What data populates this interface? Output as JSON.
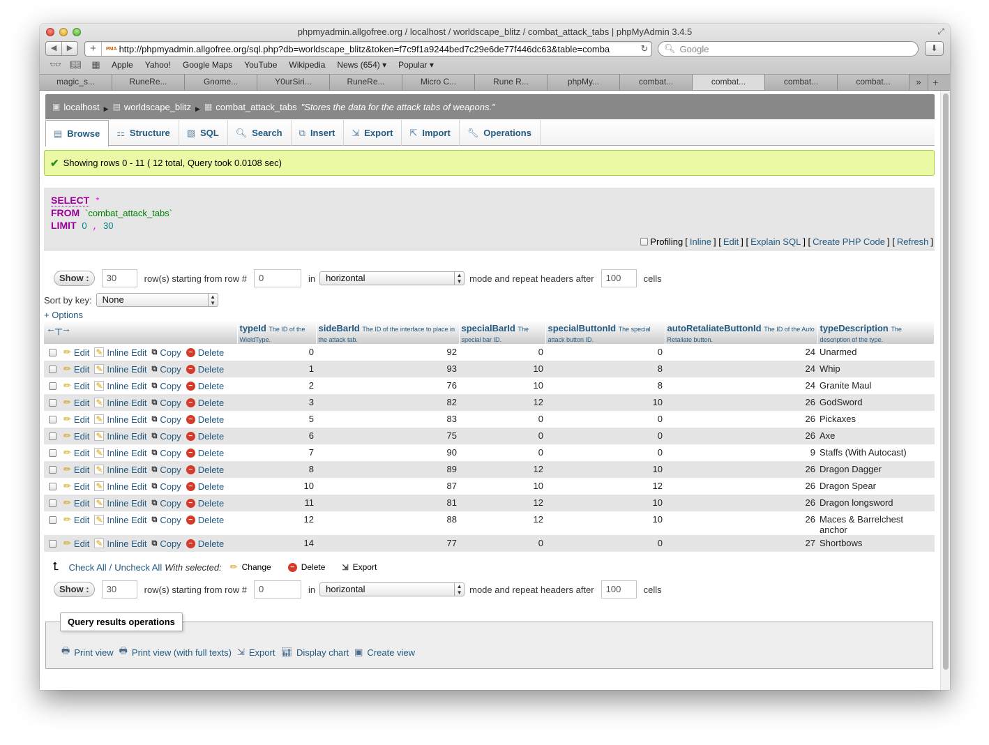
{
  "browser": {
    "window_title": "phpmyadmin.allgofree.org / localhost / worldscape_blitz / combat_attack_tabs | phpMyAdmin 3.4.5",
    "url": "http://phpmyadmin.allgofree.org/sql.php?db=worldscape_blitz&token=f7c9f1a9244bed7c29e6de77f446dc63&table=comba",
    "url_favicon": "PMA",
    "search_placeholder": "Google",
    "bookmarks": [
      "Apple",
      "Yahoo!",
      "Google Maps",
      "YouTube",
      "Wikipedia",
      "News (654) ▾",
      "Popular ▾"
    ],
    "tabs": [
      "magic_s...",
      "RuneRe...",
      "Gnome...",
      "Y0urSiri...",
      "RuneRe...",
      "Micro C...",
      "Rune R...",
      "phpMy...",
      "combat...",
      "combat...",
      "combat...",
      "combat..."
    ],
    "active_tab_index": 9
  },
  "breadcrumb": {
    "server": "localhost",
    "database": "worldscape_blitz",
    "table": "combat_attack_tabs",
    "comment": "\"Stores the data for the attack tabs of weapons.\""
  },
  "pma_tabs": [
    {
      "label": "Browse",
      "icon": "browse-icon"
    },
    {
      "label": "Structure",
      "icon": "structure-icon"
    },
    {
      "label": "SQL",
      "icon": "sql-icon"
    },
    {
      "label": "Search",
      "icon": "search-icon"
    },
    {
      "label": "Insert",
      "icon": "insert-icon"
    },
    {
      "label": "Export",
      "icon": "export-icon"
    },
    {
      "label": "Import",
      "icon": "import-icon"
    },
    {
      "label": "Operations",
      "icon": "wrench-icon"
    }
  ],
  "success_message": "Showing rows 0 - 11 ( 12 total, Query took 0.0108 sec)",
  "sql": {
    "select": "SELECT",
    "star": "*",
    "from": "FROM",
    "table": "`combat_attack_tabs`",
    "limit": "LIMIT",
    "offset": "0",
    "comma": ",",
    "count": "30"
  },
  "sql_links": {
    "profiling": "Profiling",
    "inline": "Inline",
    "edit": "Edit",
    "explain": "Explain SQL",
    "create_php": "Create PHP Code",
    "refresh": "Refresh"
  },
  "nav": {
    "show_label": "Show :",
    "rows": "30",
    "starting_text": "row(s) starting from row #",
    "start_row": "0",
    "in_text": "in",
    "mode": "horizontal",
    "mode_text": "mode and repeat headers after",
    "repeat": "100",
    "cells_text": "cells"
  },
  "sort": {
    "label": "Sort by key:",
    "value": "None"
  },
  "options_link": "+ Options",
  "columns": [
    {
      "name": "typeId",
      "comment": "The ID of the WieldType."
    },
    {
      "name": "sideBarId",
      "comment": "The ID of the interface to place in the attack tab."
    },
    {
      "name": "specialBarId",
      "comment": "The special bar ID."
    },
    {
      "name": "specialButtonId",
      "comment": "The special attack button ID."
    },
    {
      "name": "autoRetaliateButtonId",
      "comment": "The ID of the Auto Retaliate button."
    },
    {
      "name": "typeDescription",
      "comment": "The description of the type."
    }
  ],
  "row_actions": {
    "edit": "Edit",
    "inline": "Inline Edit",
    "copy": "Copy",
    "delete": "Delete"
  },
  "rows": [
    [
      "0",
      "92",
      "0",
      "0",
      "24",
      "Unarmed"
    ],
    [
      "1",
      "93",
      "10",
      "8",
      "24",
      "Whip"
    ],
    [
      "2",
      "76",
      "10",
      "8",
      "24",
      "Granite Maul"
    ],
    [
      "3",
      "82",
      "12",
      "10",
      "26",
      "GodSword"
    ],
    [
      "5",
      "83",
      "0",
      "0",
      "26",
      "Pickaxes"
    ],
    [
      "6",
      "75",
      "0",
      "0",
      "26",
      "Axe"
    ],
    [
      "7",
      "90",
      "0",
      "0",
      "9",
      "Staffs (With Autocast)"
    ],
    [
      "8",
      "89",
      "12",
      "10",
      "26",
      "Dragon Dagger"
    ],
    [
      "10",
      "87",
      "10",
      "12",
      "26",
      "Dragon Spear"
    ],
    [
      "11",
      "81",
      "12",
      "10",
      "26",
      "Dragon longsword"
    ],
    [
      "12",
      "88",
      "12",
      "10",
      "26",
      "Maces & Barrelchest anchor"
    ],
    [
      "14",
      "77",
      "0",
      "0",
      "27",
      "Shortbows"
    ]
  ],
  "with_selected": {
    "check_all": "Check All",
    "separator": "/",
    "uncheck_all": "Uncheck All",
    "label": "With selected:",
    "change": "Change",
    "delete": "Delete",
    "export": "Export"
  },
  "query_ops": {
    "legend": "Query results operations",
    "print_view": "Print view",
    "print_full": "Print view (with full texts)",
    "export": "Export",
    "chart": "Display chart",
    "create_view": "Create view"
  }
}
